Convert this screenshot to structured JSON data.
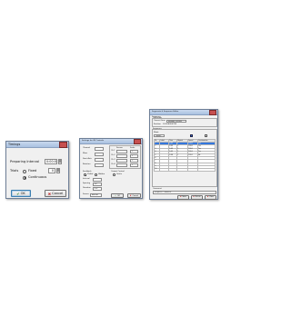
{
  "timings_dialog": {
    "title": "Timings",
    "prepare_label": "Preparing Interval",
    "prepare_value": "0:00:05",
    "trials_label": "Trials",
    "fixed_label": "Fixed",
    "fixed_value": "0",
    "continuous_label": "Continuous",
    "ok_label": "OK",
    "cancel_label": "Cancel"
  },
  "settings_dialog": {
    "title": "Settings for 3D Controls",
    "left_labels": [
      "Channel",
      "Mass",
      "Start Axis",
      "Rotation"
    ],
    "right_head": [
      "Sensor",
      "Scale"
    ],
    "right_labels": [
      "Ch 1",
      "Ch 2",
      "Ch 3",
      "Ch 4"
    ],
    "right_values": [
      "1",
      "1",
      "1",
      "1"
    ],
    "feedback_label": "Feedback",
    "feedback_opts": [
      "Visible",
      "Hidden"
    ],
    "output_label": "Output Control",
    "output_opt": "Limits",
    "misc_labels": [
      "Interval",
      "Spacing",
      "Duration"
    ],
    "misc_values": [
      "",
      "50",
      "5.0"
    ],
    "combo_label": "Source",
    "combo_value": "Box All",
    "ok_label": "OK",
    "cancel_label": "Cancel"
  },
  "sequence_dialog": {
    "title": "Segments & Sequence Editor",
    "sections": [
      "Sequence",
      "Collection",
      "Sequence"
    ],
    "collection_label": "Current Item",
    "collection_value": "Example Setting",
    "status_label": "Position",
    "status_value": "1/2/3/4/5/6/7/8",
    "option_label": "Mode",
    "option_value": "Trigger",
    "columns": [
      "Nr",
      "Label",
      "Time",
      "Repeat",
      "Speed",
      "Continuation"
    ],
    "rows": [
      [
        "1",
        "",
        "0:02",
        "1",
        "100.0",
        "Yes"
      ],
      [
        "2",
        "",
        "0:05",
        "1",
        "100.0",
        "Yes"
      ],
      [
        "3",
        "",
        "0:03",
        "1",
        "100.0",
        "Yes"
      ],
      [
        "4",
        "",
        "0:02",
        "1",
        "100.0",
        "Yes"
      ],
      [
        "5",
        "",
        "0:04",
        "1",
        "100.0",
        "No"
      ],
      [
        "6",
        "",
        "",
        "",
        "",
        ""
      ],
      [
        "7",
        "",
        "",
        "",
        "",
        ""
      ],
      [
        "8",
        "",
        "",
        "",
        "",
        ""
      ],
      [
        "9",
        "",
        "",
        "",
        "",
        ""
      ],
      [
        "10",
        "",
        "",
        "",
        "",
        ""
      ]
    ],
    "note_label": "Comment",
    "note_text": "Sequence Comment",
    "buttons": [
      "Save",
      "Delete",
      "Close"
    ]
  }
}
